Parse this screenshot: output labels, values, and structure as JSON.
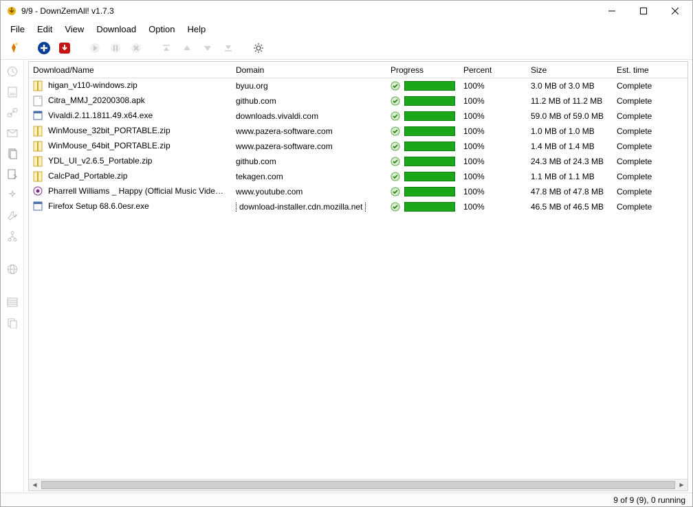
{
  "window": {
    "title": "9/9 - DownZemAll! v1.7.3"
  },
  "menu": {
    "file": "File",
    "edit": "Edit",
    "view": "View",
    "download": "Download",
    "option": "Option",
    "help": "Help"
  },
  "columns": {
    "name": "Download/Name",
    "domain": "Domain",
    "progress": "Progress",
    "percent": "Percent",
    "size": "Size",
    "est": "Est. time"
  },
  "downloads": [
    {
      "icon": "zip",
      "name": "higan_v110-windows.zip",
      "domain": "byuu.org",
      "percent": "100%",
      "size": "3.0 MB of 3.0 MB",
      "est": "Complete"
    },
    {
      "icon": "file",
      "name": "Citra_MMJ_20200308.apk",
      "domain": "github.com",
      "percent": "100%",
      "size": "11.2 MB of 11.2 MB",
      "est": "Complete"
    },
    {
      "icon": "exe",
      "name": "Vivaldi.2.11.1811.49.x64.exe",
      "domain": "downloads.vivaldi.com",
      "percent": "100%",
      "size": "59.0 MB of 59.0 MB",
      "est": "Complete"
    },
    {
      "icon": "zip",
      "name": "WinMouse_32bit_PORTABLE.zip",
      "domain": "www.pazera-software.com",
      "percent": "100%",
      "size": "1.0 MB of 1.0 MB",
      "est": "Complete"
    },
    {
      "icon": "zip",
      "name": "WinMouse_64bit_PORTABLE.zip",
      "domain": "www.pazera-software.com",
      "percent": "100%",
      "size": "1.4 MB of 1.4 MB",
      "est": "Complete"
    },
    {
      "icon": "zip",
      "name": "YDL_UI_v2.6.5_Portable.zip",
      "domain": "github.com",
      "percent": "100%",
      "size": "24.3 MB of 24.3 MB",
      "est": "Complete"
    },
    {
      "icon": "zip",
      "name": "CalcPad_Portable.zip",
      "domain": "tekagen.com",
      "percent": "100%",
      "size": "1.1 MB of 1.1 MB",
      "est": "Complete"
    },
    {
      "icon": "video",
      "name": "Pharrell Williams _ Happy (Official Music Video)....",
      "domain": "www.youtube.com",
      "percent": "100%",
      "size": "47.8 MB of 47.8 MB",
      "est": "Complete"
    },
    {
      "icon": "exe",
      "name": "Firefox Setup 68.6.0esr.exe",
      "domain": "download-installer.cdn.mozilla.net",
      "percent": "100%",
      "size": "46.5 MB of 46.5 MB",
      "est": "Complete",
      "selected": true
    }
  ],
  "status": "9 of 9 (9), 0 running"
}
